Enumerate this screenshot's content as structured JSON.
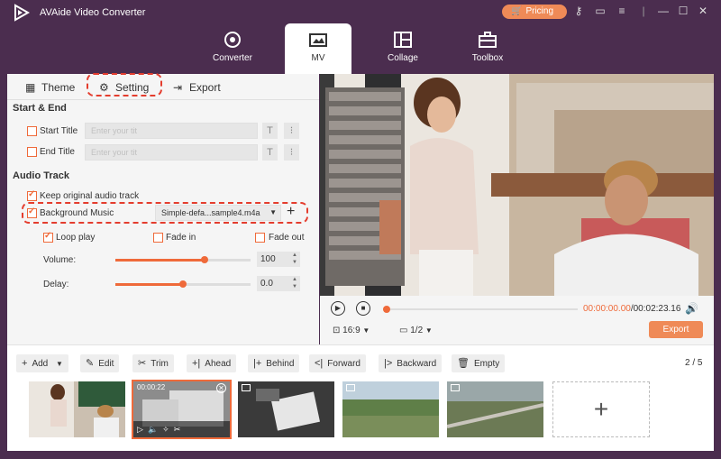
{
  "app": {
    "title": "AVAide Video Converter",
    "pricing_label": "Pricing"
  },
  "nav_tabs": [
    {
      "label": "Converter",
      "icon": "converter-icon"
    },
    {
      "label": "MV",
      "icon": "mv-icon",
      "active": true
    },
    {
      "label": "Collage",
      "icon": "collage-icon"
    },
    {
      "label": "Toolbox",
      "icon": "toolbox-icon"
    }
  ],
  "subtabs": {
    "theme": "Theme",
    "setting": "Setting",
    "export": "Export"
  },
  "start_end": {
    "section": "Start & End",
    "start_title_label": "Start Title",
    "end_title_label": "End Title",
    "start_placeholder": "Enter your tit",
    "end_placeholder": "Enter your tit"
  },
  "audio": {
    "section": "Audio Track",
    "keep_original": "Keep original audio track",
    "bg_music_label": "Background Music",
    "bg_music_file": "Simple-defa...sample4.m4a",
    "loop_play": "Loop play",
    "fade_in": "Fade in",
    "fade_out": "Fade out",
    "volume_label": "Volume:",
    "volume_value": "100",
    "volume_level": 0.66,
    "delay_label": "Delay:",
    "delay_value": "0.0",
    "delay_level": 0.5
  },
  "player": {
    "time_current": "00:00:00.00",
    "time_total": "/00:02:23.16",
    "aspect": "16:9",
    "screen": "1/2",
    "export_label": "Export"
  },
  "toolbar": {
    "add": "Add",
    "edit": "Edit",
    "trim": "Trim",
    "ahead": "Ahead",
    "behind": "Behind",
    "forward": "Forward",
    "backward": "Backward",
    "empty": "Empty",
    "page": "2 / 5"
  },
  "thumbs": {
    "selected_time": "00:00:22"
  },
  "colors": {
    "accent": "#ef6a3a",
    "titlebar": "#4b2d4f",
    "highlight_ring": "#e43d2e"
  }
}
